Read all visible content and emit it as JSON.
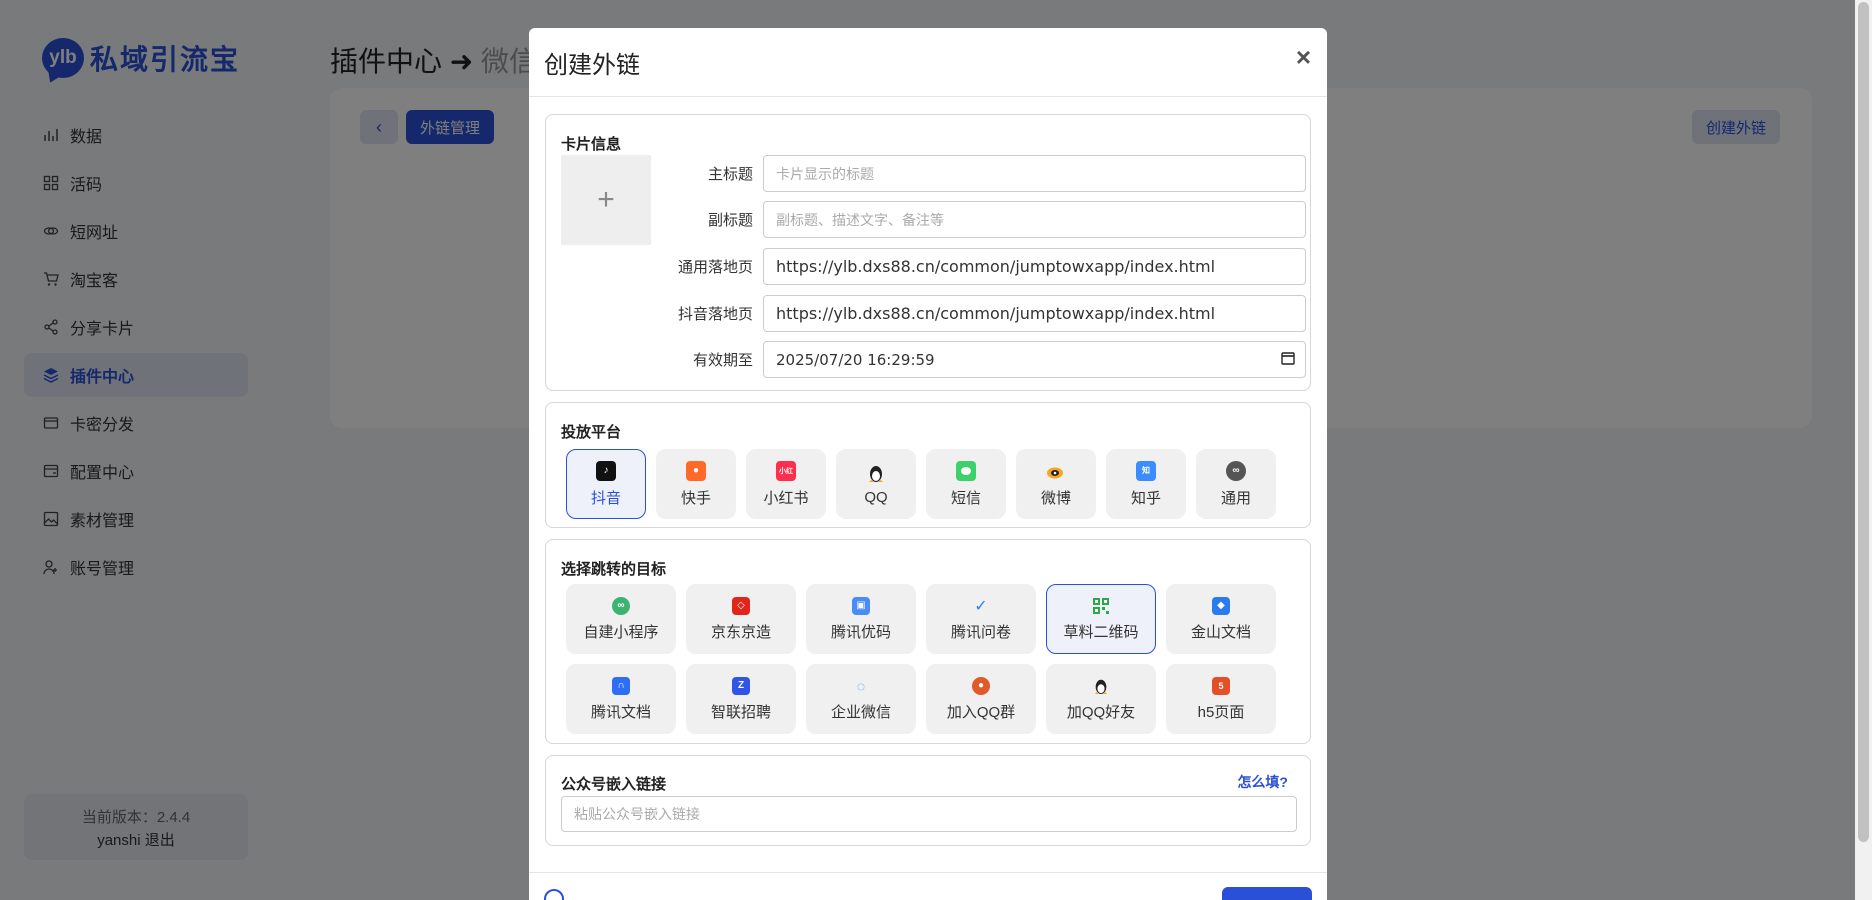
{
  "app": {
    "logo_badge": "ylb",
    "logo_text": "私域引流宝"
  },
  "sidebar": {
    "items": [
      {
        "label": "数据",
        "icon": "chart-bar-icon",
        "active": false
      },
      {
        "label": "活码",
        "icon": "grid-icon",
        "active": false
      },
      {
        "label": "短网址",
        "icon": "link-icon",
        "active": false
      },
      {
        "label": "淘宝客",
        "icon": "cart-icon",
        "active": false
      },
      {
        "label": "分享卡片",
        "icon": "share-icon",
        "active": false
      },
      {
        "label": "插件中心",
        "icon": "layers-icon",
        "active": true
      },
      {
        "label": "卡密分发",
        "icon": "folder-icon",
        "active": false
      },
      {
        "label": "配置中心",
        "icon": "settings-card-icon",
        "active": false
      },
      {
        "label": "素材管理",
        "icon": "image-icon",
        "active": false
      },
      {
        "label": "账号管理",
        "icon": "user-add-icon",
        "active": false
      }
    ],
    "version_text": "当前版本：2.4.4",
    "user_name": "yanshi",
    "logout_label": "退出"
  },
  "page": {
    "title": "插件中心 ➜",
    "title_sub": "微信",
    "back_icon": "chevron-left-icon",
    "tab_label": "外链管理",
    "create_label": "创建外链"
  },
  "modal": {
    "title": "创建外链",
    "close_icon": "close-icon",
    "card_section": {
      "title": "卡片信息",
      "upload_symbol": "+",
      "fields": {
        "main_title": {
          "label": "主标题",
          "value": "",
          "placeholder": "卡片显示的标题"
        },
        "subtitle": {
          "label": "副标题",
          "value": "",
          "placeholder": "副标题、描述文字、备注等"
        },
        "landing": {
          "label": "通用落地页",
          "value": "https://ylb.dxs88.cn/common/jumptowxapp/index.html"
        },
        "douyin_landing": {
          "label": "抖音落地页",
          "value": "https://ylb.dxs88.cn/common/jumptowxapp/index.html"
        },
        "expire": {
          "label": "有效期至",
          "value": "2025/07/20 16:29:59"
        }
      }
    },
    "platform_section": {
      "title": "投放平台",
      "items": [
        {
          "label": "抖音",
          "icon": "douyin-icon",
          "color": "#111111",
          "active": true
        },
        {
          "label": "快手",
          "icon": "kuaishou-icon",
          "color": "#ff6a2b",
          "active": false
        },
        {
          "label": "小红书",
          "icon": "xiaohongshu-icon",
          "color": "#ff2e4d",
          "active": false
        },
        {
          "label": "QQ",
          "icon": "qq-penguin-icon",
          "color": "#222222",
          "active": false
        },
        {
          "label": "短信",
          "icon": "sms-icon",
          "color": "#3ed16b",
          "active": false
        },
        {
          "label": "微博",
          "icon": "weibo-icon",
          "color": "#f5a623",
          "active": false
        },
        {
          "label": "知乎",
          "icon": "zhihu-icon",
          "color": "#3a8cff",
          "active": false
        },
        {
          "label": "通用",
          "icon": "link-icon",
          "color": "#555555",
          "active": false
        }
      ]
    },
    "target_section": {
      "title": "选择跳转的目标",
      "items": [
        {
          "label": "自建小程序",
          "icon": "miniprogram-icon",
          "color": "#3cb371",
          "active": false
        },
        {
          "label": "京东京造",
          "icon": "jd-box-icon",
          "color": "#e1251b",
          "active": false
        },
        {
          "label": "腾讯优码",
          "icon": "tencent-cube-icon",
          "color": "#4a8cf7",
          "active": false
        },
        {
          "label": "腾讯问卷",
          "icon": "check-survey-icon",
          "color": "#2d7ff9",
          "active": false
        },
        {
          "label": "草料二维码",
          "icon": "qrcode-icon",
          "color": "#2aa84a",
          "active": true
        },
        {
          "label": "金山文档",
          "icon": "kingsoft-doc-icon",
          "color": "#2b7bf0",
          "active": false
        },
        {
          "label": "腾讯文档",
          "icon": "tencent-doc-icon",
          "color": "#2d6ef5",
          "active": false
        },
        {
          "label": "智联招聘",
          "icon": "zhaopin-icon",
          "color": "#2e55e6",
          "active": false
        },
        {
          "label": "企业微信",
          "icon": "wecom-icon",
          "color": "#3b8cf0",
          "active": false
        },
        {
          "label": "加入QQ群",
          "icon": "qq-group-icon",
          "color": "#e05a2b",
          "active": false
        },
        {
          "label": "加QQ好友",
          "icon": "qq-friend-icon",
          "color": "#222222",
          "active": false
        },
        {
          "label": "h5页面",
          "icon": "html5-icon",
          "color": "#e34f26",
          "active": false
        }
      ]
    },
    "embed_section": {
      "title": "公众号嵌入链接",
      "help_label": "怎么填?",
      "placeholder": "粘贴公众号嵌入链接"
    }
  },
  "colors": {
    "accent": "#2b50d8",
    "overlay": "rgba(0,0,0,0.5)"
  }
}
